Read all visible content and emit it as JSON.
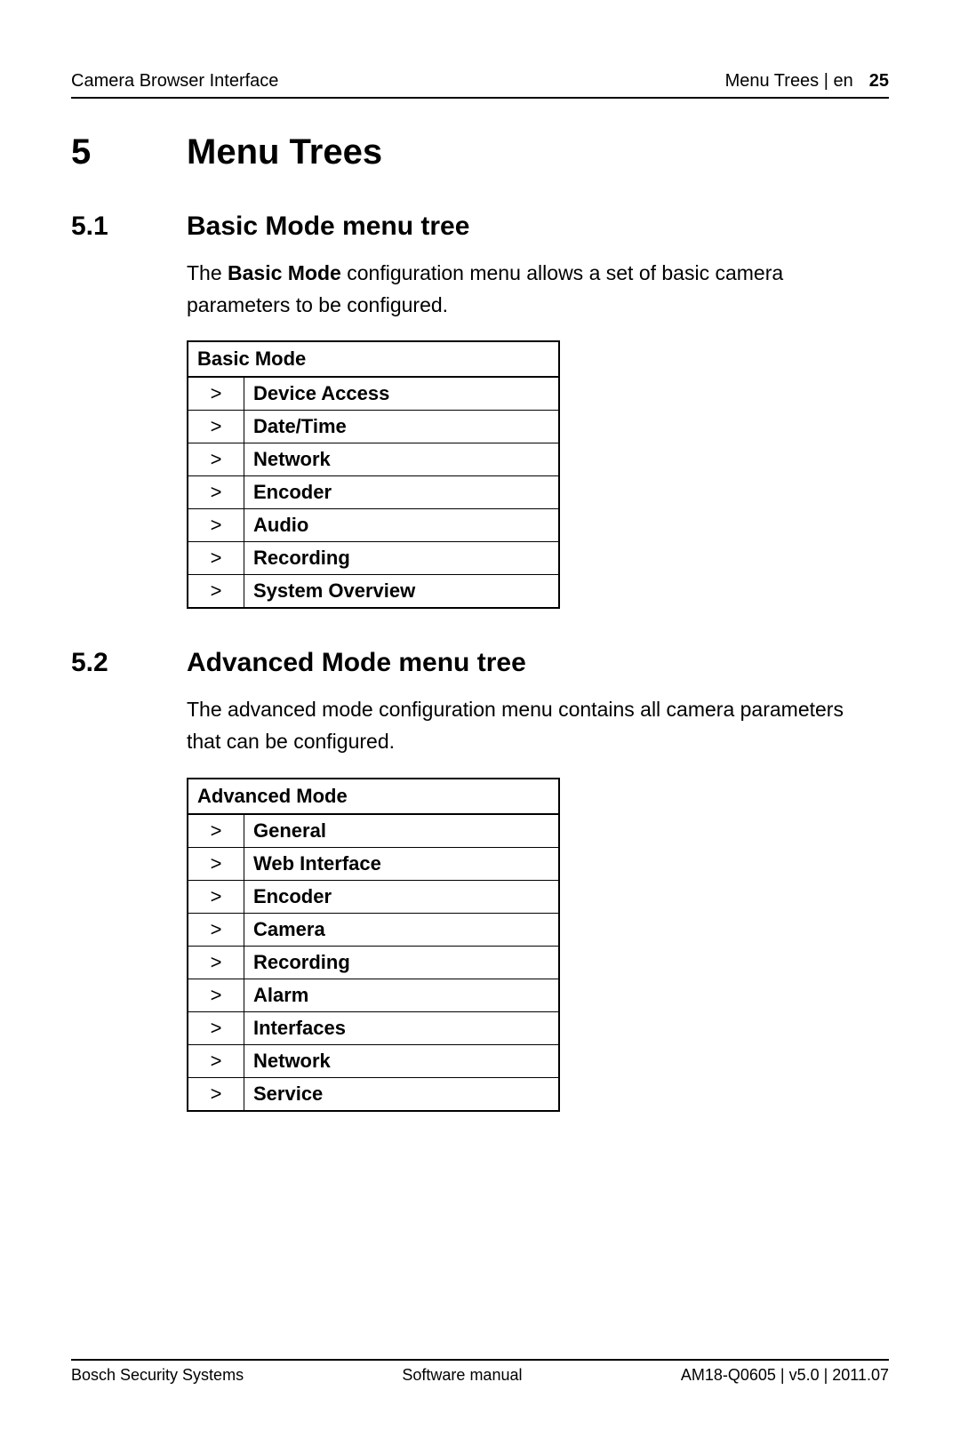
{
  "header": {
    "left": "Camera Browser Interface",
    "right": "Menu Trees | en",
    "page_num": "25"
  },
  "chapter": {
    "num": "5",
    "title": "Menu Trees"
  },
  "sec51": {
    "num": "5.1",
    "title": "Basic Mode menu tree",
    "para_pre": "The ",
    "para_bold": "Basic Mode",
    "para_post": " configuration menu allows a set of basic camera parameters to be configured.",
    "table_header": "Basic Mode",
    "items": [
      "Device Access",
      "Date/Time",
      "Network",
      "Encoder",
      "Audio",
      "Recording",
      "System Overview"
    ]
  },
  "sec52": {
    "num": "5.2",
    "title": "Advanced Mode menu tree",
    "para": "The advanced mode configuration menu contains all camera parameters that can be configured.",
    "table_header": "Advanced Mode",
    "items": [
      "General",
      "Web Interface",
      "Encoder",
      "Camera",
      "Recording",
      "Alarm",
      "Interfaces",
      "Network",
      "Service"
    ]
  },
  "footer": {
    "left": "Bosch Security Systems",
    "center": "Software manual",
    "right": "AM18-Q0605 | v5.0 | 2011.07"
  },
  "arrow": ">"
}
